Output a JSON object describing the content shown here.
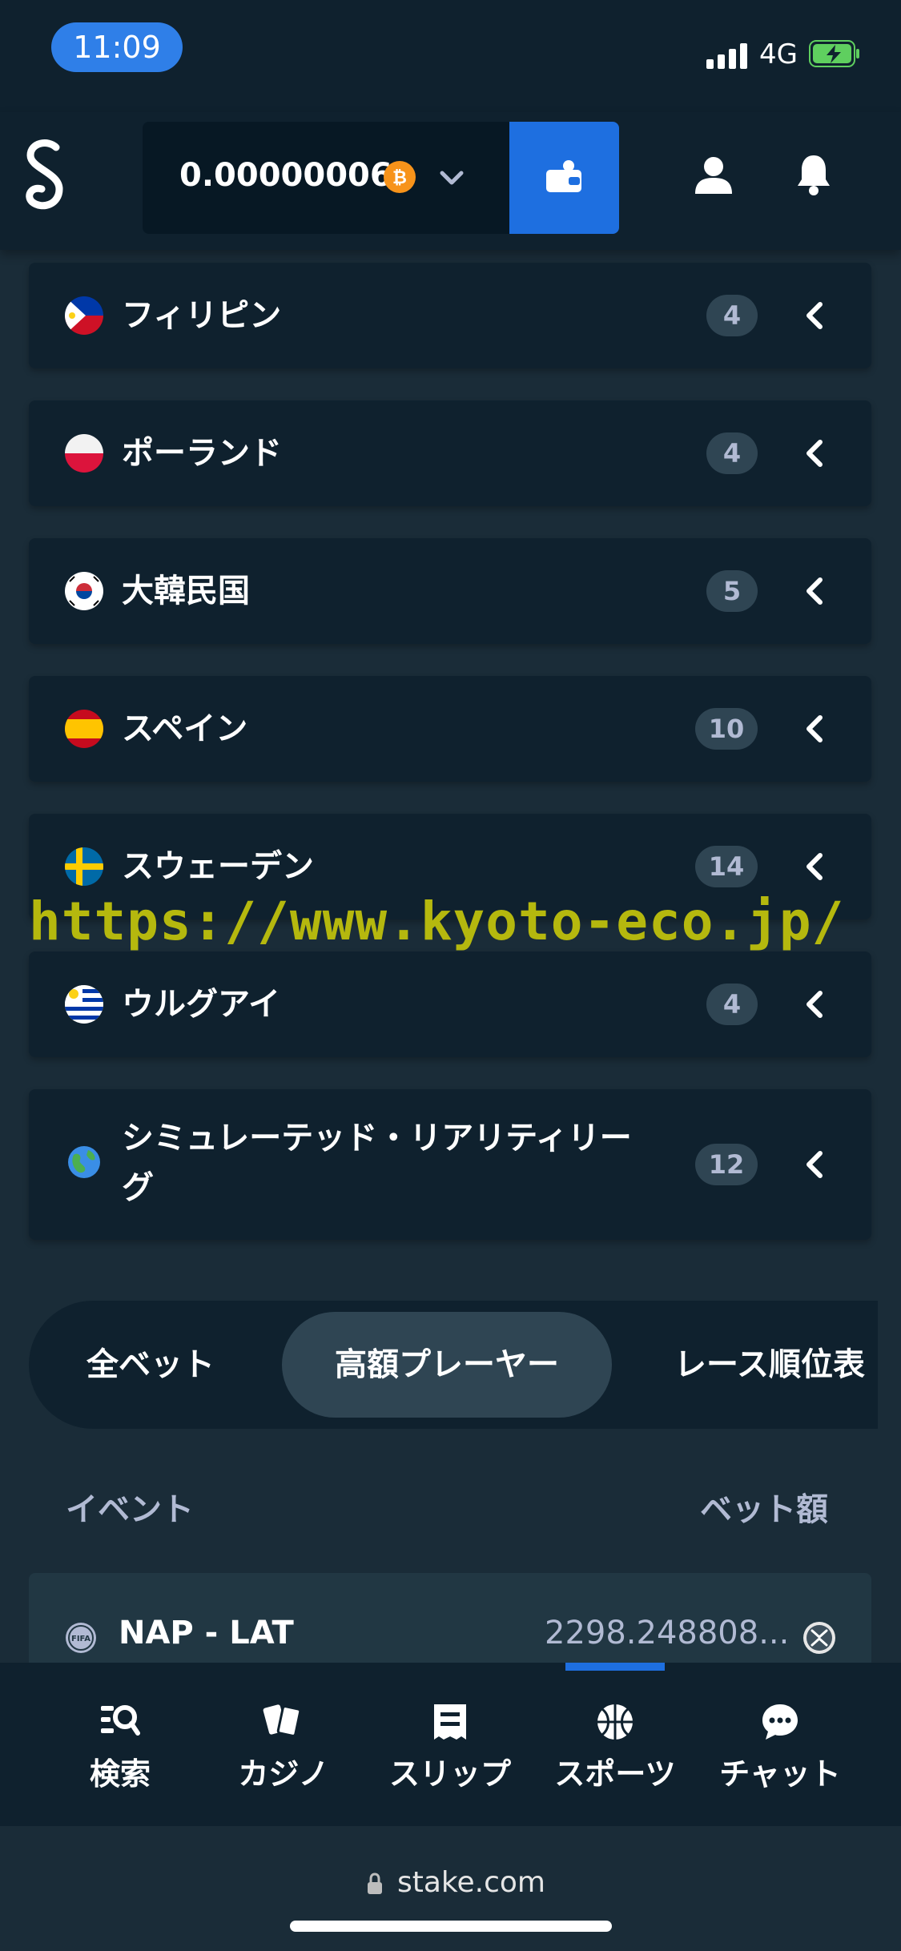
{
  "status_bar": {
    "time": "11:09",
    "network": "4G"
  },
  "header": {
    "balance": "0.00000006",
    "currency_icon": "bitcoin-icon",
    "wallet_icon": "wallet-icon",
    "accent": "#1e6fe0"
  },
  "countries": [
    {
      "name": "フィリピン",
      "count": "4",
      "flag": "philippines-flag-icon"
    },
    {
      "name": "ポーランド",
      "count": "4",
      "flag": "poland-flag-icon"
    },
    {
      "name": "大韓民国",
      "count": "5",
      "flag": "south-korea-flag-icon"
    },
    {
      "name": "スペイン",
      "count": "10",
      "flag": "spain-flag-icon"
    },
    {
      "name": "スウェーデン",
      "count": "14",
      "flag": "sweden-flag-icon"
    },
    {
      "name": "ウルグアイ",
      "count": "4",
      "flag": "uruguay-flag-icon"
    },
    {
      "name_line1": "シミュレーテッド・リアリティリー",
      "name_line2": "グ",
      "count": "12",
      "flag": "globe-icon"
    }
  ],
  "watermark": "https://www.kyoto-eco.jp/",
  "tabs": [
    {
      "label": "全ベット",
      "active": false
    },
    {
      "label": "高額プレーヤー",
      "active": true
    },
    {
      "label": "レース順位表",
      "active": false
    }
  ],
  "table": {
    "col_event": "イベント",
    "col_amount": "ベット額",
    "rows": [
      {
        "event": "NAP - LAT",
        "amount": "2298.248808...",
        "icon": "fifa-icon",
        "currency_icon": "xrp-icon"
      }
    ]
  },
  "bottom_nav": [
    {
      "label": "検索",
      "icon": "search-icon"
    },
    {
      "label": "カジノ",
      "icon": "cards-icon"
    },
    {
      "label": "スリップ",
      "icon": "betslip-icon"
    },
    {
      "label": "スポーツ",
      "icon": "basketball-icon",
      "active": true
    },
    {
      "label": "チャット",
      "icon": "chat-icon"
    }
  ],
  "browser": {
    "url": "stake.com"
  }
}
